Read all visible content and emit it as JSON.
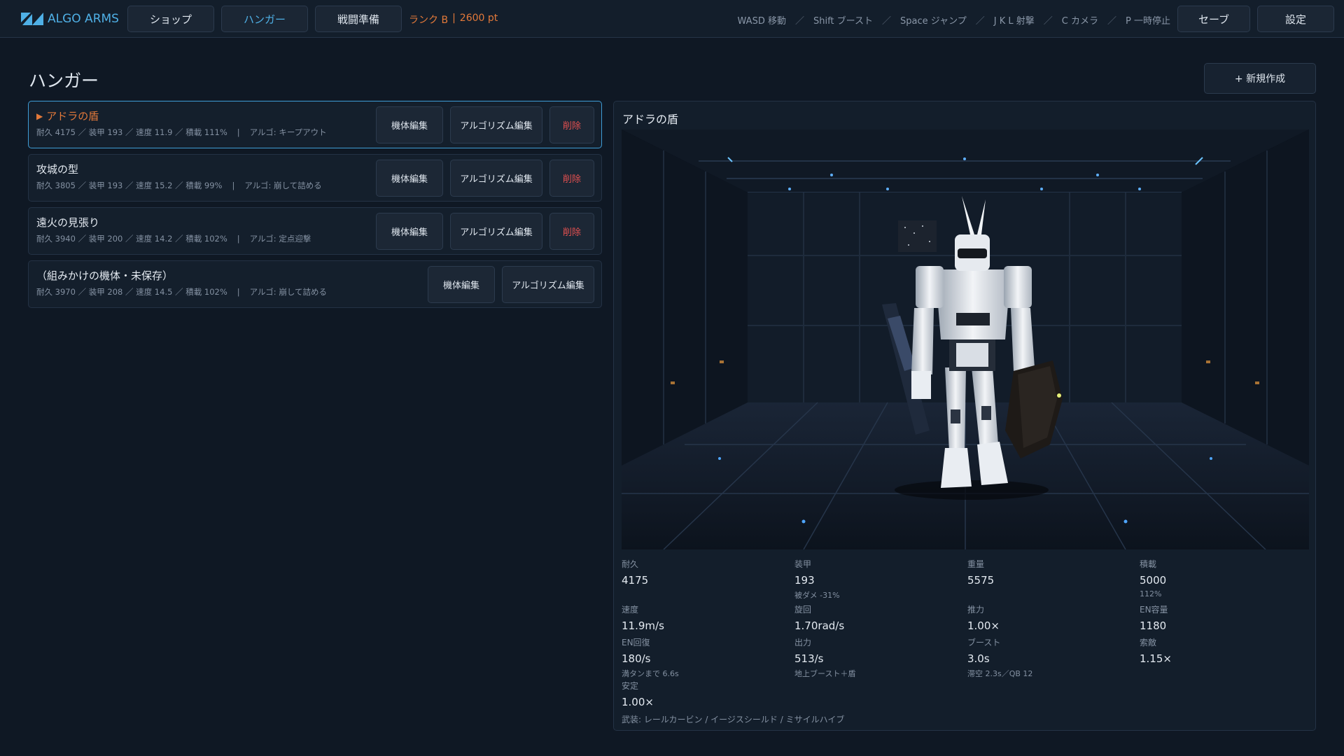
{
  "app": {
    "name": "ALGO ARMS"
  },
  "nav": {
    "shop": "ショップ",
    "hangar": "ハンガー",
    "battle_prep": "戦闘準備"
  },
  "rank": {
    "label": "ランク B",
    "points": "2600 pt"
  },
  "hints": [
    "WASD 移動",
    "Shift ブースト",
    "Space ジャンプ",
    "J K L 射撃",
    "C カメラ",
    "P 一時停止"
  ],
  "header_buttons": {
    "save": "セーブ",
    "settings": "設定"
  },
  "page": {
    "title": "ハンガー",
    "new_button": "+ 新規作成"
  },
  "units": [
    {
      "name": "アドラの盾",
      "stats": "耐久 4175 ／ 装甲 193 ／ 速度 11.9 ／ 積載 111%",
      "algo": "アルゴ: キープアウト",
      "selected": true,
      "deletable": true
    },
    {
      "name": "攻城の型",
      "stats": "耐久 3805 ／ 装甲 193 ／ 速度 15.2 ／ 積載 99%",
      "algo": "アルゴ: 崩して詰める",
      "selected": false,
      "deletable": true
    },
    {
      "name": "遠火の見張り",
      "stats": "耐久 3940 ／ 装甲 200 ／ 速度 14.2 ／ 積載 102%",
      "algo": "アルゴ: 定点迎撃",
      "selected": false,
      "deletable": true
    },
    {
      "name": "（組みかけの機体・未保存）",
      "stats": "耐久 3970 ／ 装甲 208 ／ 速度 14.5 ／ 積載 102%",
      "algo": "アルゴ: 崩して詰める",
      "selected": false,
      "deletable": false
    }
  ],
  "unit_buttons": {
    "edit_frame": "機体編集",
    "edit_algo": "アルゴリズム編集",
    "delete": "削除"
  },
  "detail": {
    "title": "アドラの盾",
    "stats": [
      {
        "label": "耐久",
        "value": "4175",
        "sub": ""
      },
      {
        "label": "装甲",
        "value": "193",
        "sub": "被ダメ -31%"
      },
      {
        "label": "重量",
        "value": "5575",
        "sub": ""
      },
      {
        "label": "積載",
        "value": "5000",
        "sub": "112%"
      },
      {
        "label": "速度",
        "value": "11.9m/s",
        "sub": ""
      },
      {
        "label": "旋回",
        "value": "1.70rad/s",
        "sub": ""
      },
      {
        "label": "推力",
        "value": "1.00×",
        "sub": ""
      },
      {
        "label": "EN容量",
        "value": "1180",
        "sub": ""
      },
      {
        "label": "EN回復",
        "value": "180/s",
        "sub": "満タンまで 6.6s"
      },
      {
        "label": "出力",
        "value": "513/s",
        "sub": "地上ブースト＋盾"
      },
      {
        "label": "ブースト",
        "value": "3.0s",
        "sub": "滞空 2.3s／QB 12"
      },
      {
        "label": "索敵",
        "value": "1.15×",
        "sub": ""
      },
      {
        "label": "安定",
        "value": "1.00×",
        "sub": ""
      }
    ],
    "armament": "武装: レールカービン / イージスシールド / ミサイルハイブ"
  },
  "colors": {
    "accent": "#4fb0e6",
    "rank": "#e3793a",
    "danger": "#e35050",
    "bg": "#0f1824"
  }
}
